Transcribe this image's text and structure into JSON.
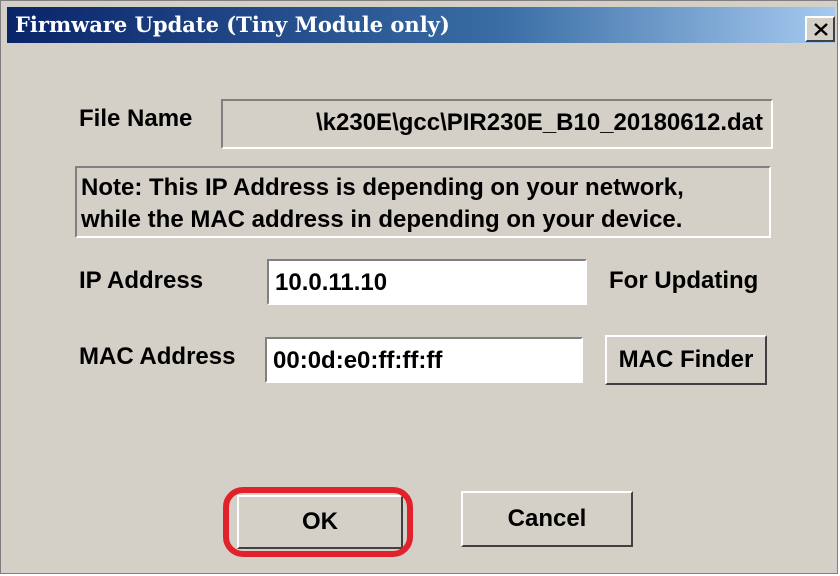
{
  "window": {
    "title": "Firmware Update (Tiny Module only)",
    "close_glyph": "×"
  },
  "file_name": {
    "label": "File Name",
    "value": "\\k230E\\gcc\\PIR230E_B10_20180612.dat"
  },
  "note": {
    "line1": "Note: This IP Address is depending on your network,",
    "line2": "while the  MAC address in depending on your device."
  },
  "ip": {
    "label": "IP Address",
    "value": "10.0.11.10",
    "suffix": "For Updating"
  },
  "mac": {
    "label": "MAC Address",
    "value": "00:0d:e0:ff:ff:ff",
    "finder_label": "MAC Finder"
  },
  "buttons": {
    "ok": "OK",
    "cancel": "Cancel"
  },
  "colors": {
    "titlebar_start": "#0a246a",
    "titlebar_end": "#a6caf0",
    "dialog_bg": "#d4d0c8",
    "highlight": "#e2222b"
  }
}
